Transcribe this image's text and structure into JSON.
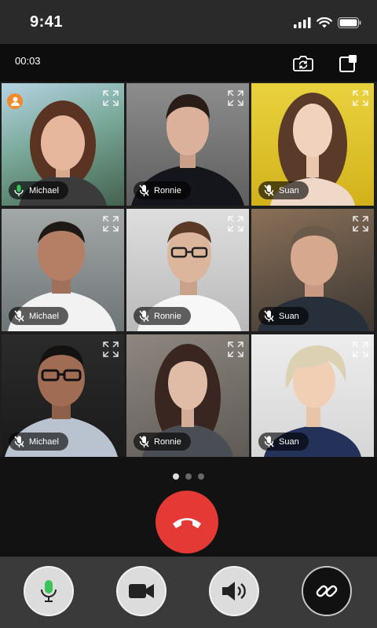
{
  "status_bar": {
    "time": "9:41",
    "icons": [
      "cellular-signal-icon",
      "wifi-icon",
      "battery-icon"
    ]
  },
  "call": {
    "elapsed": "00:03"
  },
  "participants": [
    {
      "name": "Michael",
      "host": true,
      "mic": "on"
    },
    {
      "name": "Ronnie",
      "mic": "off"
    },
    {
      "name": "Suan",
      "mic": "off"
    },
    {
      "name": "Michael",
      "mic": "off"
    },
    {
      "name": "Ronnie",
      "mic": "off"
    },
    {
      "name": "Suan",
      "mic": "off"
    },
    {
      "name": "Michael",
      "mic": "off"
    },
    {
      "name": "Ronnie",
      "mic": "off"
    },
    {
      "name": "Suan",
      "mic": "off"
    }
  ],
  "pager": {
    "pages": 3,
    "current": 1
  },
  "colors": {
    "end_call": "#e53935",
    "mic_active": "#3cc45a",
    "host_badge": "#f08a2c"
  },
  "toolbar": [
    "microphone-icon",
    "video-camera-icon",
    "speaker-icon",
    "link-icon"
  ]
}
